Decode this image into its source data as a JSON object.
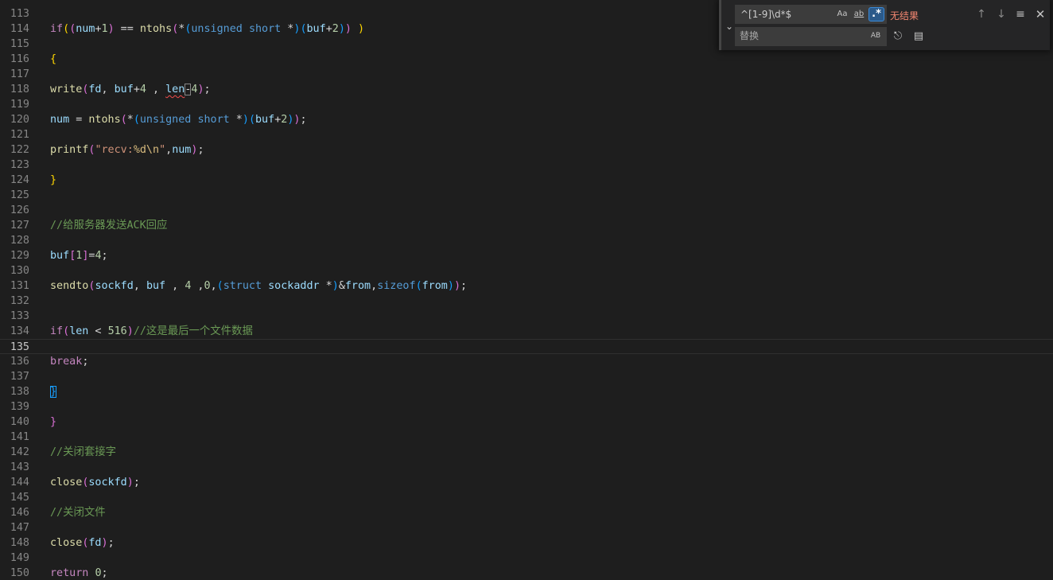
{
  "editor": {
    "lines": [
      {
        "n": "113",
        "tokens": []
      },
      {
        "n": "114",
        "tokens": [
          [
            "kw",
            "if"
          ],
          [
            "b1",
            "("
          ],
          [
            "b2",
            "("
          ],
          [
            "var",
            "num"
          ],
          [
            "op",
            "+"
          ],
          [
            "num",
            "1"
          ],
          [
            "b2",
            ")"
          ],
          [
            "op",
            " == "
          ],
          [
            "fn",
            "ntohs"
          ],
          [
            "b2",
            "("
          ],
          [
            "op",
            "*"
          ],
          [
            "b3",
            "("
          ],
          [
            "type",
            "unsigned"
          ],
          [
            "op",
            " "
          ],
          [
            "type",
            "short"
          ],
          [
            "op",
            " *"
          ],
          [
            "b3",
            ")"
          ],
          [
            "b3",
            "("
          ],
          [
            "var",
            "buf"
          ],
          [
            "op",
            "+"
          ],
          [
            "num",
            "2"
          ],
          [
            "b3",
            ")"
          ],
          [
            "b2",
            ")"
          ],
          [
            "op",
            " "
          ],
          [
            "b1",
            ")"
          ]
        ]
      },
      {
        "n": "115",
        "tokens": []
      },
      {
        "n": "116",
        "tokens": [
          [
            "b1",
            "{"
          ]
        ]
      },
      {
        "n": "117",
        "tokens": []
      },
      {
        "n": "118",
        "tokens": [
          [
            "fn",
            "write"
          ],
          [
            "b2",
            "("
          ],
          [
            "var",
            "fd"
          ],
          [
            "op",
            ", "
          ],
          [
            "var",
            "buf"
          ],
          [
            "op",
            "+"
          ],
          [
            "num",
            "4"
          ],
          [
            "op",
            " , "
          ],
          [
            "var squig",
            "len"
          ],
          [
            "op bracket-match",
            "-"
          ],
          [
            "num",
            "4"
          ],
          [
            "b2",
            ")"
          ],
          [
            "op",
            ";"
          ]
        ]
      },
      {
        "n": "119",
        "tokens": []
      },
      {
        "n": "120",
        "tokens": [
          [
            "var",
            "num"
          ],
          [
            "op",
            " = "
          ],
          [
            "fn",
            "ntohs"
          ],
          [
            "b2",
            "("
          ],
          [
            "op",
            "*"
          ],
          [
            "b3",
            "("
          ],
          [
            "type",
            "unsigned"
          ],
          [
            "op",
            " "
          ],
          [
            "type",
            "short"
          ],
          [
            "op",
            " *"
          ],
          [
            "b3",
            ")"
          ],
          [
            "b3",
            "("
          ],
          [
            "var",
            "buf"
          ],
          [
            "op",
            "+"
          ],
          [
            "num",
            "2"
          ],
          [
            "b3",
            ")"
          ],
          [
            "b2",
            ")"
          ],
          [
            "op",
            ";"
          ]
        ]
      },
      {
        "n": "121",
        "tokens": []
      },
      {
        "n": "122",
        "tokens": [
          [
            "fn",
            "printf"
          ],
          [
            "b2",
            "("
          ],
          [
            "str",
            "\"recv:"
          ],
          [
            "esc",
            "%d\\n"
          ],
          [
            "str",
            "\""
          ],
          [
            "op",
            ","
          ],
          [
            "var",
            "num"
          ],
          [
            "b2",
            ")"
          ],
          [
            "op",
            ";"
          ]
        ]
      },
      {
        "n": "123",
        "tokens": []
      },
      {
        "n": "124",
        "tokens": [
          [
            "b1",
            "}"
          ]
        ]
      },
      {
        "n": "125",
        "tokens": []
      },
      {
        "n": "126",
        "tokens": []
      },
      {
        "n": "127",
        "tokens": [
          [
            "cm",
            "//给服务器发送ACK回应"
          ]
        ]
      },
      {
        "n": "128",
        "tokens": []
      },
      {
        "n": "129",
        "tokens": [
          [
            "var",
            "buf"
          ],
          [
            "b2",
            "["
          ],
          [
            "num",
            "1"
          ],
          [
            "b2",
            "]"
          ],
          [
            "op",
            "="
          ],
          [
            "num",
            "4"
          ],
          [
            "op",
            ";"
          ]
        ]
      },
      {
        "n": "130",
        "tokens": []
      },
      {
        "n": "131",
        "tokens": [
          [
            "fn",
            "sendto"
          ],
          [
            "b2",
            "("
          ],
          [
            "var",
            "sockfd"
          ],
          [
            "op",
            ", "
          ],
          [
            "var",
            "buf"
          ],
          [
            "op",
            " , "
          ],
          [
            "num",
            "4"
          ],
          [
            "op",
            " ,"
          ],
          [
            "num",
            "0"
          ],
          [
            "op",
            ","
          ],
          [
            "b3",
            "("
          ],
          [
            "type",
            "struct"
          ],
          [
            "op",
            " "
          ],
          [
            "var",
            "sockaddr"
          ],
          [
            "op",
            " *"
          ],
          [
            "b3",
            ")"
          ],
          [
            "op",
            "&"
          ],
          [
            "var",
            "from"
          ],
          [
            "op",
            ","
          ],
          [
            "type",
            "sizeof"
          ],
          [
            "b3",
            "("
          ],
          [
            "var",
            "from"
          ],
          [
            "b3",
            ")"
          ],
          [
            "b2",
            ")"
          ],
          [
            "op",
            ";"
          ]
        ]
      },
      {
        "n": "132",
        "tokens": []
      },
      {
        "n": "133",
        "tokens": []
      },
      {
        "n": "134",
        "tokens": [
          [
            "kw",
            "if"
          ],
          [
            "b2",
            "("
          ],
          [
            "var",
            "len"
          ],
          [
            "op",
            " < "
          ],
          [
            "num",
            "516"
          ],
          [
            "b2",
            ")"
          ],
          [
            "cm",
            "//这是最后一个文件数据"
          ]
        ]
      },
      {
        "n": "135",
        "tokens": [],
        "current": true
      },
      {
        "n": "136",
        "tokens": [
          [
            "kw",
            "break"
          ],
          [
            "op",
            ";"
          ]
        ]
      },
      {
        "n": "137",
        "tokens": []
      },
      {
        "n": "138",
        "tokens": [
          [
            "b3 cur-bracket",
            "}"
          ]
        ]
      },
      {
        "n": "139",
        "tokens": []
      },
      {
        "n": "140",
        "tokens": [
          [
            "b2",
            "}"
          ]
        ]
      },
      {
        "n": "141",
        "tokens": []
      },
      {
        "n": "142",
        "tokens": [
          [
            "cm",
            "//关闭套接字"
          ]
        ]
      },
      {
        "n": "143",
        "tokens": []
      },
      {
        "n": "144",
        "tokens": [
          [
            "fn",
            "close"
          ],
          [
            "b2",
            "("
          ],
          [
            "var",
            "sockfd"
          ],
          [
            "b2",
            ")"
          ],
          [
            "op",
            ";"
          ]
        ]
      },
      {
        "n": "145",
        "tokens": []
      },
      {
        "n": "146",
        "tokens": [
          [
            "cm",
            "//关闭文件"
          ]
        ]
      },
      {
        "n": "147",
        "tokens": []
      },
      {
        "n": "148",
        "tokens": [
          [
            "fn",
            "close"
          ],
          [
            "b2",
            "("
          ],
          [
            "var",
            "fd"
          ],
          [
            "b2",
            ")"
          ],
          [
            "op",
            ";"
          ]
        ]
      },
      {
        "n": "149",
        "tokens": []
      },
      {
        "n": "150",
        "tokens": [
          [
            "kw",
            "return"
          ],
          [
            "op",
            " "
          ],
          [
            "num",
            "0"
          ],
          [
            "op",
            ";"
          ]
        ]
      }
    ]
  },
  "find_widget": {
    "toggle_icon": "chevron-down-icon",
    "find_value": "^[1-9]\\d*$",
    "match_case_label": "Aa",
    "whole_word_label": "ab",
    "regex_label": ".*",
    "match_count": "无结果",
    "replace_placeholder": "替换",
    "preserve_case_label": "AB",
    "prev_icon": "arrow-up-icon",
    "next_icon": "arrow-down-icon",
    "selection_icon": "find-in-selection-icon",
    "close_icon": "close-icon",
    "replace_one_icon": "replace-icon",
    "replace_all_icon": "replace-all-icon"
  }
}
